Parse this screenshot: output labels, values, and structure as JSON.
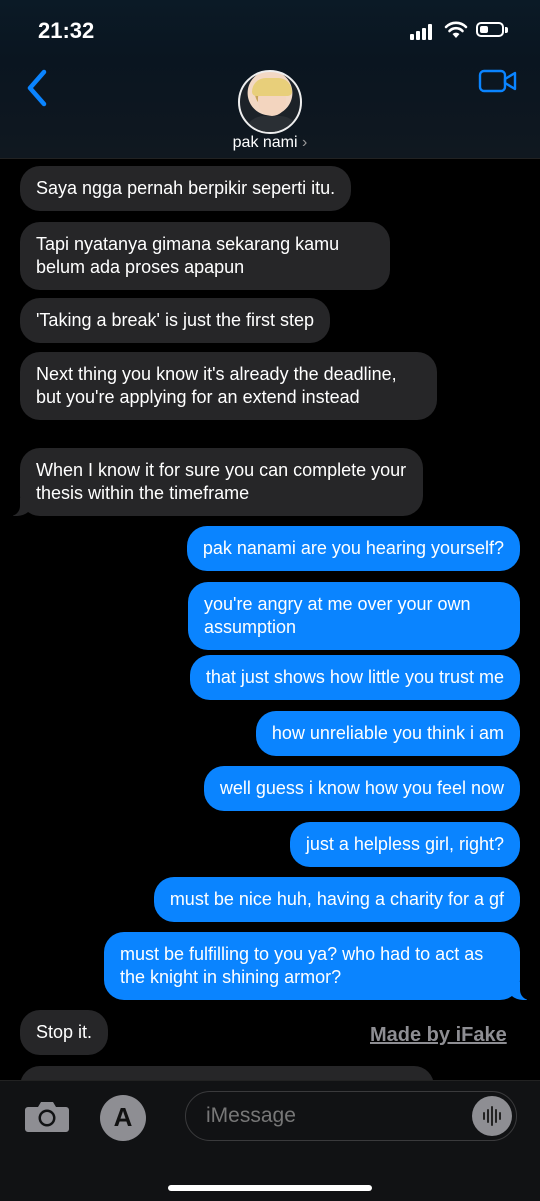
{
  "status_bar": {
    "time": "21:32"
  },
  "header": {
    "contact_name": "pak nami",
    "chevron": "›",
    "icons": {
      "back": "chevron-left-icon",
      "video": "video-camera-icon"
    },
    "accent_color": "#0a84ff"
  },
  "messages": [
    {
      "direction": "incoming",
      "text": "Saya ngga pernah berpikir seperti itu."
    },
    {
      "direction": "incoming",
      "text": "Tapi nyatanya gimana sekarang kamu belum ada proses apapun"
    },
    {
      "direction": "incoming",
      "text": "'Taking a break' is just the first step"
    },
    {
      "direction": "incoming",
      "text": "Next thing you know it's already the deadline, but you're applying for an extend instead"
    },
    {
      "direction": "incoming",
      "text": "When I know it for sure you can complete your thesis within the timeframe"
    },
    {
      "direction": "outgoing",
      "text": "pak nanami are you hearing yourself?"
    },
    {
      "direction": "outgoing",
      "text": "you're angry at me over your own assumption"
    },
    {
      "direction": "outgoing",
      "text": "that just shows how little you trust me"
    },
    {
      "direction": "outgoing",
      "text": "how unreliable you think i am"
    },
    {
      "direction": "outgoing",
      "text": "well guess i know how you feel now"
    },
    {
      "direction": "outgoing",
      "text": "just a helpless girl, right?"
    },
    {
      "direction": "outgoing",
      "text": "must be nice huh, having a charity for a gf"
    },
    {
      "direction": "outgoing",
      "text": "must be fulfilling to you ya? who had to act as the knight in shining armor?"
    },
    {
      "direction": "incoming",
      "text": "Stop it."
    }
  ],
  "watermark": "Made by iFake",
  "composer": {
    "placeholder": "iMessage",
    "icons": {
      "camera": "camera-icon",
      "apps": "app-store-icon",
      "voice": "waveform-icon"
    }
  },
  "colors": {
    "outgoing_bubble": "#0a84ff",
    "incoming_bubble": "#262628"
  }
}
